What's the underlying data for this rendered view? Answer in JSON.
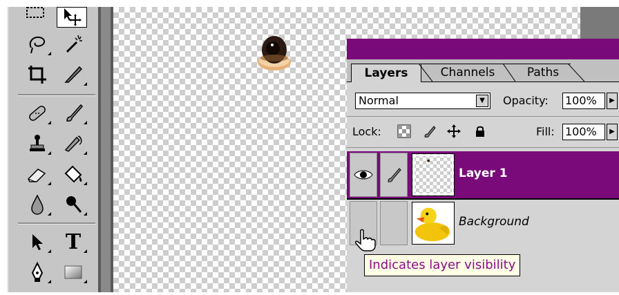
{
  "toolbox": {
    "tools": [
      {
        "name": "marquee-tool-icon"
      },
      {
        "name": "move-tool-icon"
      },
      {
        "name": "lasso-tool-icon"
      },
      {
        "name": "magic-wand-tool-icon"
      },
      {
        "name": "crop-tool-icon"
      },
      {
        "name": "slice-tool-icon"
      },
      {
        "name": "healing-brush-tool-icon"
      },
      {
        "name": "brush-tool-icon"
      },
      {
        "name": "clone-stamp-tool-icon"
      },
      {
        "name": "history-brush-tool-icon"
      },
      {
        "name": "eraser-tool-icon"
      },
      {
        "name": "paint-bucket-tool-icon"
      },
      {
        "name": "blur-tool-icon"
      },
      {
        "name": "burn-tool-icon"
      },
      {
        "name": "path-selection-tool-icon"
      },
      {
        "name": "type-tool-icon"
      },
      {
        "name": "pen-tool-icon"
      },
      {
        "name": "rectangle-tool-icon"
      }
    ],
    "type_tool_glyph": "T"
  },
  "layers_palette": {
    "tabs": [
      {
        "label": "Layers",
        "active": true
      },
      {
        "label": "Channels",
        "active": false
      },
      {
        "label": "Paths",
        "active": false
      }
    ],
    "blend_mode": "Normal",
    "opacity_label": "Opacity:",
    "opacity_value": "100%",
    "lock_label": "Lock:",
    "fill_label": "Fill:",
    "fill_value": "100%",
    "layers": [
      {
        "name": "Layer 1",
        "selected": true,
        "visible": true
      },
      {
        "name": "Background",
        "selected": false,
        "visible": false
      }
    ]
  },
  "tooltip": {
    "text": "Indicates layer visibility"
  },
  "colors": {
    "palette_accent": "#7a0a7a",
    "tooltip_text": "#8a0a8a",
    "panel_gray": "#d4d4d4"
  }
}
